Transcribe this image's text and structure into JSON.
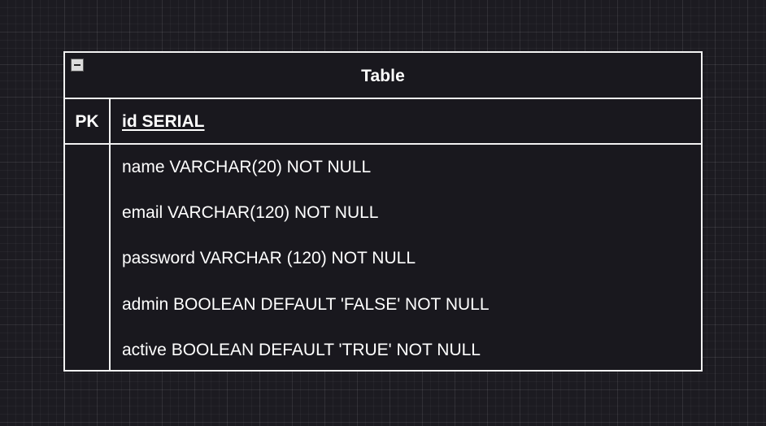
{
  "table": {
    "title": "Table",
    "primary_key": {
      "label": "PK",
      "field": "id SERIAL"
    },
    "fields": [
      "name VARCHAR(20) NOT NULL",
      "email VARCHAR(120) NOT NULL",
      "password VARCHAR (120) NOT NULL",
      "admin BOOLEAN DEFAULT 'FALSE' NOT NULL",
      "active BOOLEAN DEFAULT 'TRUE' NOT NULL"
    ]
  },
  "icons": {
    "collapse": "minus-square-icon"
  },
  "colors": {
    "canvas_background": "#1c1b21",
    "table_background": "#19181e",
    "border": "#f2f2f2",
    "text": "#ffffff"
  }
}
